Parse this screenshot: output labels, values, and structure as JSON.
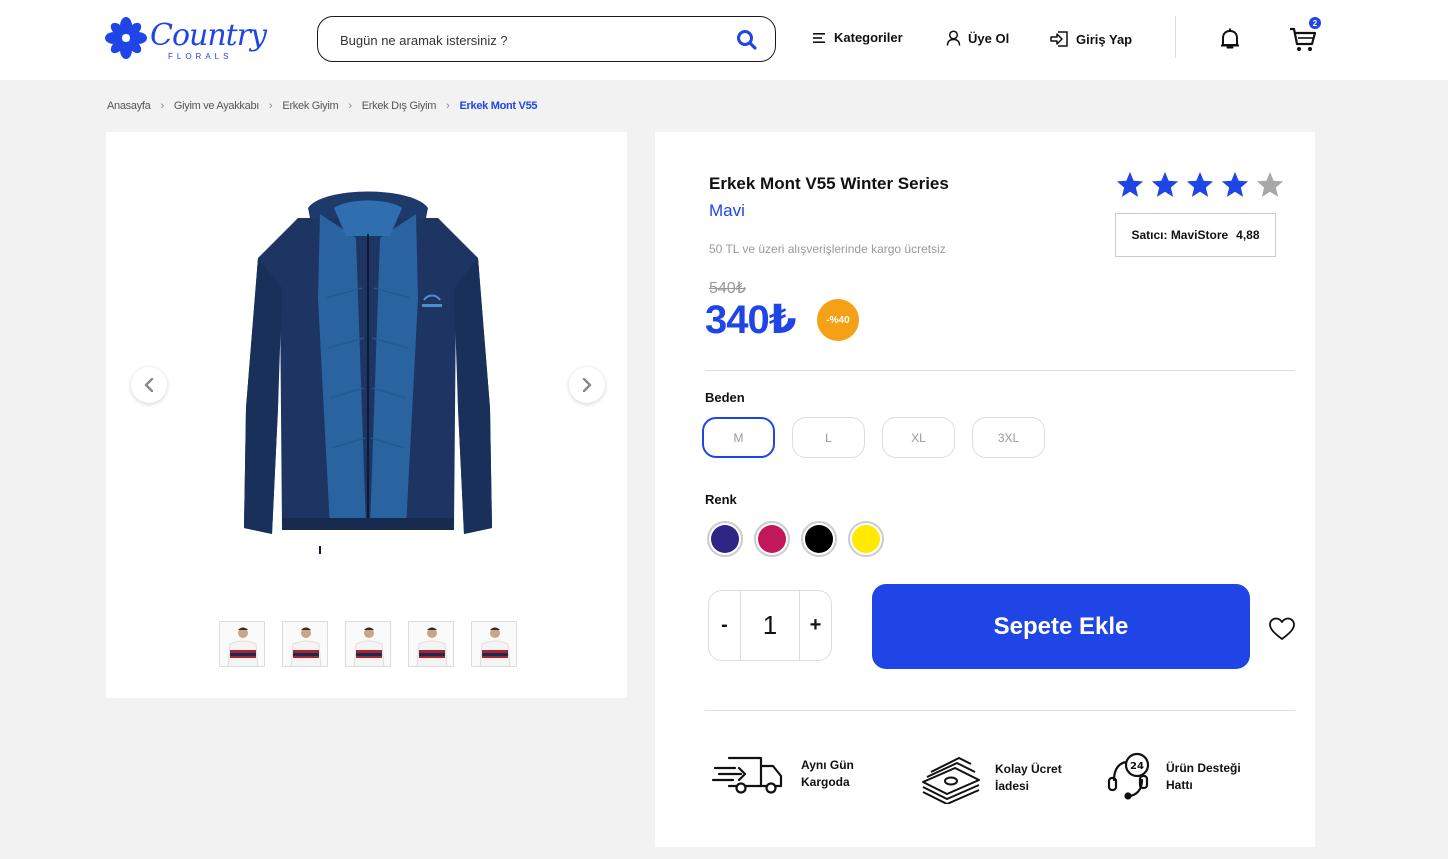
{
  "brand": {
    "name": "Country",
    "tagline": "FLORALS"
  },
  "search": {
    "placeholder": "Bugün ne aramak istersiniz ?"
  },
  "nav": {
    "categories": "Kategoriler",
    "register": "Üye Ol",
    "login": "Giriş Yap"
  },
  "cart": {
    "count": "2"
  },
  "breadcrumb": [
    "Anasayfa",
    "Giyim ve Ayakkabı",
    "Erkek Giyim",
    "Erkek Dış Giyim",
    "Erkek Mont V55"
  ],
  "product": {
    "title": "Erkek Mont V55 Winter Series",
    "color_name": "Mavi",
    "shipping_note": "50 TL ve üzeri alışverişlerinde kargo ücretsiz",
    "rating": 4,
    "rating_max": 5,
    "seller_label": "Satıcı: MaviStore",
    "seller_score": "4,88",
    "old_price": "540₺",
    "new_price": "340₺",
    "discount": "-%40"
  },
  "options": {
    "size_label": "Beden",
    "sizes": [
      "M",
      "L",
      "XL",
      "3XL"
    ],
    "selected_size": "M",
    "color_label": "Renk",
    "colors": [
      "#2e2585",
      "#c2185b",
      "#000000",
      "#ffea00"
    ]
  },
  "quantity": {
    "minus": "-",
    "value": "1",
    "plus": "+"
  },
  "add_to_cart": "Sepete Ekle",
  "features": [
    {
      "icon": "truck-icon",
      "line1": "Aynı Gün",
      "line2": "Kargoda"
    },
    {
      "icon": "money-stack-icon",
      "line1": "Kolay Ücret",
      "line2": "İadesi"
    },
    {
      "icon": "headset-24-icon",
      "line1": "Ürün Desteği",
      "line2": "Hattı"
    }
  ],
  "colors": {
    "accent": "#1f45e6",
    "discount": "#f5a115"
  }
}
